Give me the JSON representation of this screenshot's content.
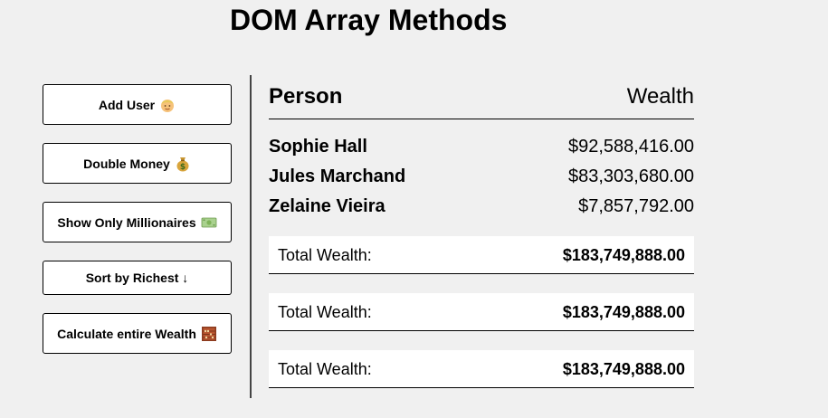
{
  "page": {
    "title": "DOM Array Methods"
  },
  "buttons": {
    "add_user": "Add User",
    "double_money": "Double Money",
    "show_millionaires": "Show Only Millionaires",
    "sort_richest": "Sort by Richest ↓",
    "calculate_wealth": "Calculate entire Wealth"
  },
  "table": {
    "person_header": "Person",
    "wealth_header": "Wealth",
    "people": [
      {
        "name": "Sophie Hall",
        "money": "$92,588,416.00"
      },
      {
        "name": "Jules Marchand",
        "money": "$83,303,680.00"
      },
      {
        "name": "Zelaine Vieira",
        "money": "$7,857,792.00"
      }
    ],
    "totals": [
      {
        "label": "Total Wealth:",
        "value": "$183,749,888.00"
      },
      {
        "label": "Total Wealth:",
        "value": "$183,749,888.00"
      },
      {
        "label": "Total Wealth:",
        "value": "$183,749,888.00"
      }
    ]
  },
  "icons": {
    "add_user": "person-emoji-icon",
    "double_money": "money-bag-icon",
    "show_millionaires": "dollar-banknote-icon",
    "calculate_wealth": "abacus-icon"
  }
}
